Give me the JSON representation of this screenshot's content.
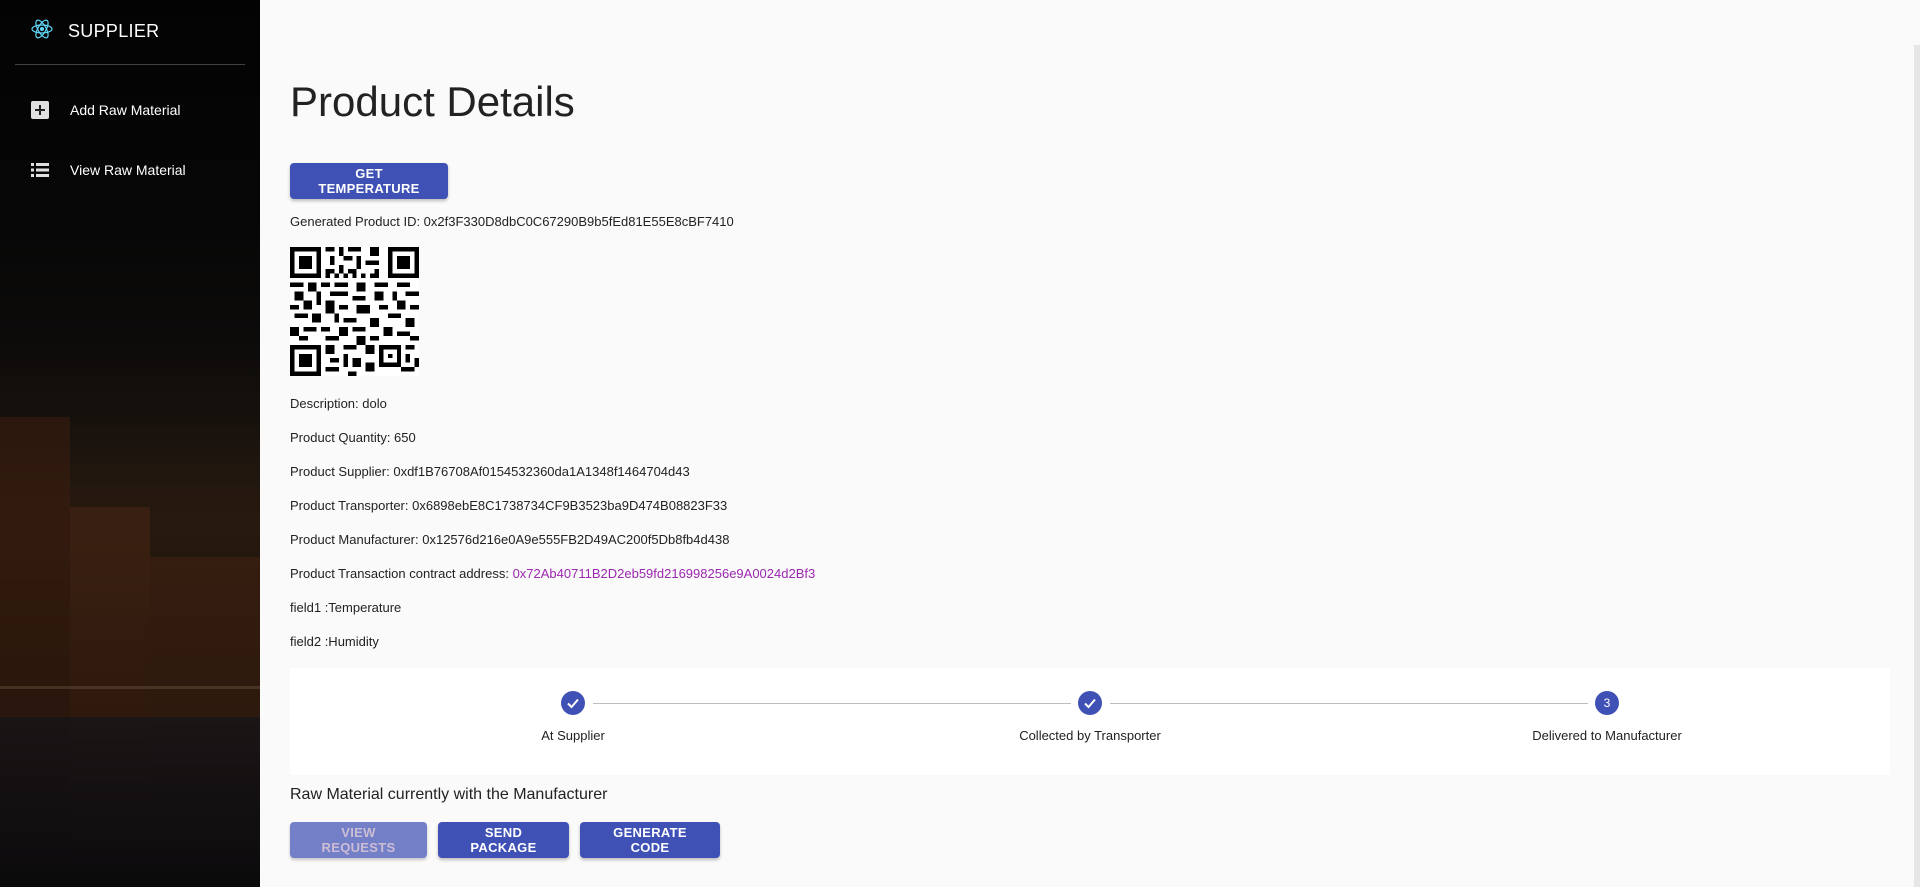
{
  "sidebar": {
    "brand": "SUPPLIER",
    "brand_icon": "react-atom-icon",
    "items": [
      {
        "label": "Add Raw Material",
        "icon": "add-box-icon"
      },
      {
        "label": "View Raw Material",
        "icon": "list-icon"
      }
    ]
  },
  "page": {
    "title": "Product Details",
    "temperature_button": "GET TEMPERATURE",
    "product_id": "Generated Product ID: 0x2f3F330D8dbC0C67290B9b5fEd81E55E8cBF7410",
    "description": "Description: dolo",
    "quantity": "Product Quantity: 650",
    "supplier": "Product Supplier: 0xdf1B76708Af0154532360da1A1348f1464704d43",
    "transporter": "Product Transporter: 0x6898ebE8C1738734CF9B3523ba9D474B08823F33",
    "manufacturer": "Product Manufacturer: 0x12576d216e0A9e555FB2D49AC200f5Db8fb4d438",
    "contract_label": "Product Transaction contract address: ",
    "contract_address": "0x72Ab40711B2D2eb59fd216998256e9A0024d2Bf3",
    "field1": "field1 :Temperature",
    "field2": "field2 :Humidity"
  },
  "stepper": {
    "steps": [
      {
        "label": "At Supplier",
        "state": "completed"
      },
      {
        "label": "Collected by Transporter",
        "state": "completed"
      },
      {
        "label": "Delivered to Manufacturer",
        "state": "active",
        "number": "3"
      }
    ]
  },
  "status": "Raw Material currently with the Manufacturer",
  "actions": {
    "view_requests": "VIEW REQUESTS",
    "send_package": "SEND PACKAGE",
    "generate_code": "GENERATE CODE"
  },
  "colors": {
    "primary": "#3f51b5",
    "link": "#9c27b0"
  }
}
